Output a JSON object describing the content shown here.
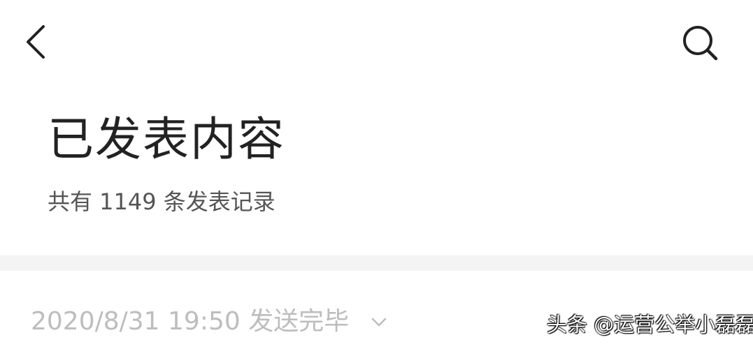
{
  "navigation": {
    "back_icon": "chevron-left-icon",
    "search_icon": "search-icon"
  },
  "header": {
    "title": "已发表内容",
    "record_count": "共有 1149 条发表记录"
  },
  "entries": [
    {
      "status_text": "2020/8/31 19:50 发送完毕",
      "expand_icon": "chevron-down-icon"
    }
  ],
  "watermark": {
    "text": "头条 @运营公举小磊磊"
  },
  "colors": {
    "title": "#222222",
    "subtitle": "#555555",
    "entry_text": "#bdbdbd",
    "divider": "#f4f4f4",
    "background": "#ffffff"
  }
}
